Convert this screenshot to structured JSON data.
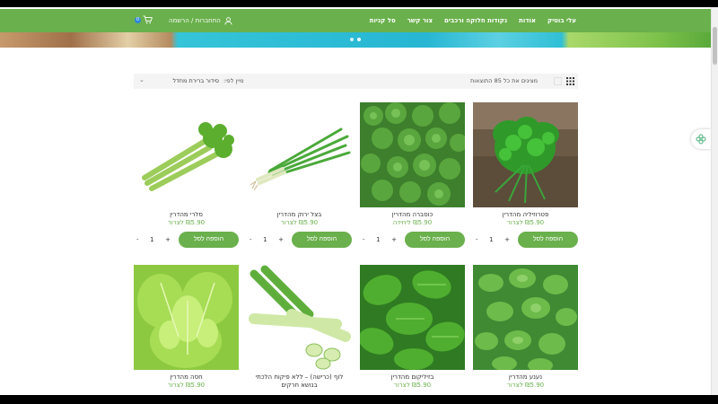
{
  "nav": {
    "logo": "עלי בוטיק",
    "links": [
      "אודות",
      "נקודות חלוקה ורכבים",
      "צור קשר",
      "סל קניות"
    ],
    "account": "התחברות / הרשמה",
    "cart_count": "0"
  },
  "toolbar": {
    "result_count": "מציגים את כל 85 התוצאות",
    "sort_label": "מיין לפי:",
    "sort_value": "סידור ברירת מחדל"
  },
  "products": [
    {
      "title": "פטרוזיליה מהדרין",
      "price": "₪5.90 לצרור",
      "qty": "1",
      "add": "הוספה לסל",
      "icon": "parsley-image"
    },
    {
      "title": "כוסברה מהדרין",
      "price": "₪5.90 ליחידה",
      "qty": "1",
      "add": "הוספה לסל",
      "icon": "coriander-image"
    },
    {
      "title": "בצל ירוק מהדרין",
      "price": "₪5.90 לצרור",
      "qty": "1",
      "add": "הוספה לסל",
      "icon": "green-onion-image"
    },
    {
      "title": "סלרי מהדרין",
      "price": "₪5.90 לצרור",
      "qty": "1",
      "add": "הוספה לסל",
      "icon": "celery-image"
    },
    {
      "title": "נענע מהדרין",
      "price": "₪5.90 לצרור",
      "icon": "mint-image"
    },
    {
      "title": "בזיליקום מהדרין",
      "price": "₪5.90 לצרור",
      "icon": "basil-image"
    },
    {
      "title": "לוף (כרישה) – ללא פיקוח הלכתי בנושא חרקים",
      "price": "",
      "icon": "leek-image"
    },
    {
      "title": "חסה מהדרין",
      "price": "₪5.90 לצרור",
      "icon": "lettuce-image"
    }
  ],
  "colors": {
    "brand": "#6ab04c",
    "badge": "#2e86de"
  }
}
